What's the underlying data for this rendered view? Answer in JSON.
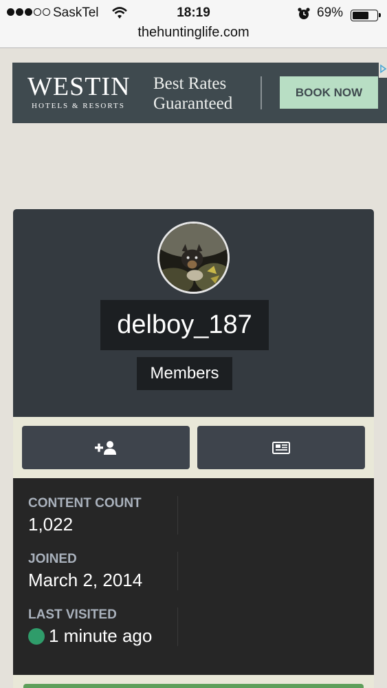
{
  "status_bar": {
    "carrier": "SaskTel",
    "time": "18:19",
    "battery_percent": "69%",
    "battery_level": 0.69
  },
  "browser": {
    "url": "thehuntinglife.com"
  },
  "ad": {
    "brand_name": "WESTIN",
    "brand_sub": "HOTELS & RESORTS",
    "tagline_line1": "Best Rates",
    "tagline_line2": "Guaranteed",
    "cta_label": "BOOK NOW",
    "colors": {
      "background": "#3f4a4f",
      "cta": "#b8dec4"
    }
  },
  "profile": {
    "username": "delboy_187",
    "group": "Members",
    "actions": [
      {
        "name": "follow-button",
        "icon": "add-user-icon"
      },
      {
        "name": "content-button",
        "icon": "newspaper-icon"
      }
    ],
    "stats": [
      {
        "label": "CONTENT COUNT",
        "value": "1,022"
      },
      {
        "label": "JOINED",
        "value": "March 2, 2014"
      },
      {
        "label": "LAST VISITED",
        "value": "1 minute ago",
        "online": true
      }
    ],
    "colors": {
      "card": "#343a40",
      "stats_bg": "#262626",
      "online": "#2f9c6a"
    }
  }
}
